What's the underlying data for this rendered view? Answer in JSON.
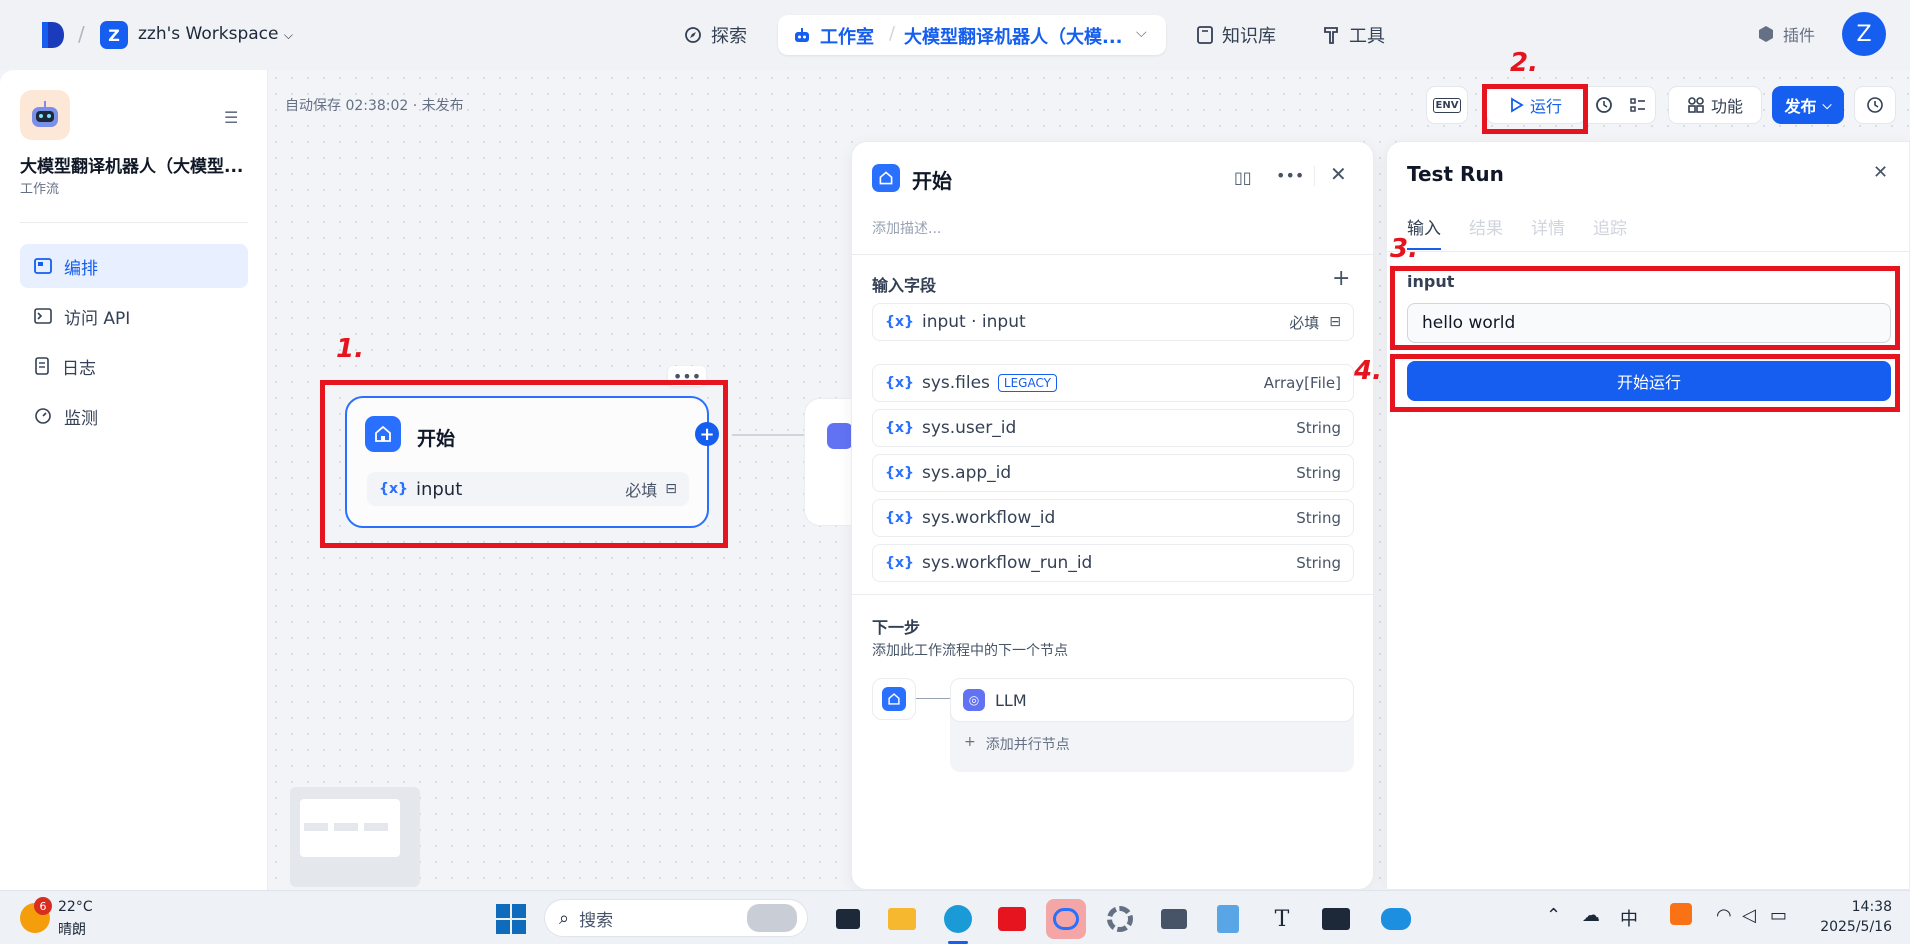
{
  "topbar": {
    "workspace_initial": "Z",
    "workspace_name": "zzh's Workspace",
    "nav": {
      "explore": "探索",
      "studio": "工作室",
      "app_name": "大模型翻译机器人（大模...",
      "knowledge": "知识库",
      "tools": "工具",
      "plugins": "插件"
    },
    "user_initial": "Z"
  },
  "sidebar": {
    "app_title": "大模型翻译机器人（大模型...",
    "app_type": "工作流",
    "items": [
      {
        "label": "编排",
        "icon": "layout-icon"
      },
      {
        "label": "访问 API",
        "icon": "terminal-icon"
      },
      {
        "label": "日志",
        "icon": "file-icon"
      },
      {
        "label": "监测",
        "icon": "gauge-icon"
      }
    ]
  },
  "canvas": {
    "autosave": "自动保存 02:38:02 · 未发布",
    "toolbar": {
      "env": "ENV",
      "run": "运行",
      "features": "功能",
      "publish": "发布"
    },
    "start_node": {
      "title": "开始",
      "var_label": "{x}",
      "var_name": "input",
      "required": "必填"
    },
    "annotations": [
      "1.",
      "2.",
      "3.",
      "4."
    ]
  },
  "start_panel": {
    "title": "开始",
    "desc_placeholder": "添加描述...",
    "input_fields_label": "输入字段",
    "fields": [
      {
        "name": "input · input",
        "right": "必填",
        "badge": ""
      },
      {
        "name": "sys.files",
        "right": "Array[File]",
        "badge": "LEGACY"
      },
      {
        "name": "sys.user_id",
        "right": "String",
        "badge": ""
      },
      {
        "name": "sys.app_id",
        "right": "String",
        "badge": ""
      },
      {
        "name": "sys.workflow_id",
        "right": "String",
        "badge": ""
      },
      {
        "name": "sys.workflow_run_id",
        "right": "String",
        "badge": ""
      }
    ],
    "next_step_title": "下一步",
    "next_step_desc": "添加此工作流程中的下一个节点",
    "next_node": "LLM",
    "add_parallel": "添加并行节点"
  },
  "test_run": {
    "title": "Test Run",
    "tabs": [
      "输入",
      "结果",
      "详情",
      "追踪"
    ],
    "input_label": "input",
    "input_value": "hello world",
    "start_button": "开始运行"
  },
  "taskbar": {
    "weather_badge": "6",
    "temperature": "22°C",
    "weather": "晴朗",
    "search_placeholder": "搜索",
    "time": "14:38",
    "date": "2025/5/16"
  },
  "colors": {
    "primary": "#155eef",
    "annotation": "#e5141f"
  }
}
